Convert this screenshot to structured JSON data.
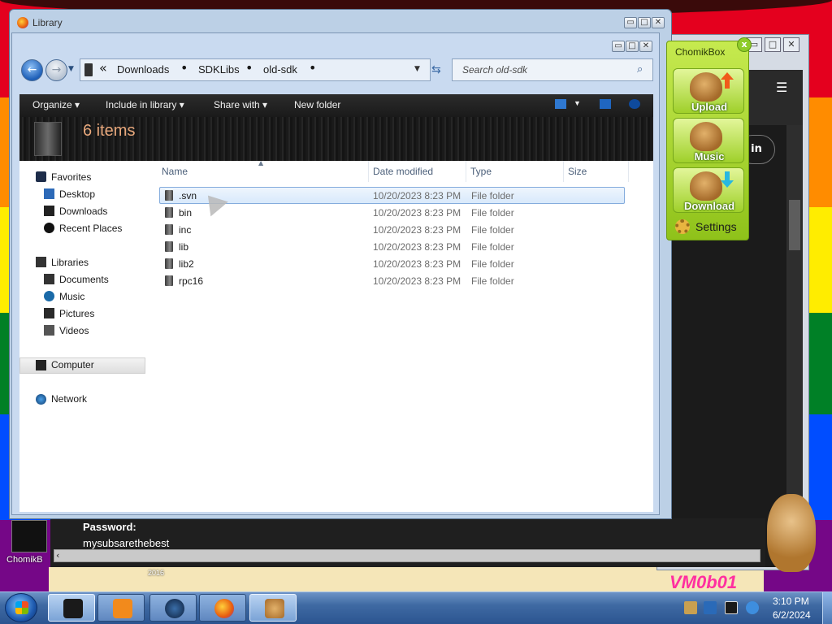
{
  "explorer": {
    "window_title": "Library",
    "breadcrumb": [
      "Downloads",
      "SDKLibs",
      "old-sdk"
    ],
    "search_placeholder": "Search old-sdk",
    "toolbar": {
      "organize": "Organize",
      "include_in_library": "Include in library",
      "share_with": "Share with",
      "new_folder": "New folder"
    },
    "item_count": "6 items",
    "nav_pane": {
      "favorites": "Favorites",
      "desktop": "Desktop",
      "downloads": "Downloads",
      "recent_places": "Recent Places",
      "libraries": "Libraries",
      "documents": "Documents",
      "music": "Music",
      "pictures": "Pictures",
      "videos": "Videos",
      "computer": "Computer",
      "network": "Network"
    },
    "columns": {
      "name": "Name",
      "date": "Date modified",
      "type": "Type",
      "size": "Size"
    },
    "files": [
      {
        "name": ".svn",
        "date": "10/20/2023 8:23 PM",
        "type": "File folder"
      },
      {
        "name": "bin",
        "date": "10/20/2023 8:23 PM",
        "type": "File folder"
      },
      {
        "name": "inc",
        "date": "10/20/2023 8:23 PM",
        "type": "File folder"
      },
      {
        "name": "lib",
        "date": "10/20/2023 8:23 PM",
        "type": "File folder"
      },
      {
        "name": "lib2",
        "date": "10/20/2023 8:23 PM",
        "type": "File folder"
      },
      {
        "name": "rpc16",
        "date": "10/20/2023 8:23 PM",
        "type": "File folder"
      }
    ],
    "selected_row": 0
  },
  "chomikbox": {
    "title": "ChomikBox",
    "close": "x",
    "upload": "Upload",
    "music": "Music",
    "download": "Download",
    "settings": "Settings"
  },
  "background_page": {
    "password_label": "Password:",
    "password_value": "mysubsarethebest",
    "login_button": "in"
  },
  "desktop": {
    "icon_label": "ChomikB",
    "logo_text": "VM0b01",
    "small_text": "2016"
  },
  "taskbar": {
    "time": "3:10 PM",
    "date": "6/2/2024"
  },
  "colors": {
    "chomik_green": "#9fd02a",
    "explorer_toolbar": "#1a1a1a",
    "item_count_text": "#e8a87c",
    "selection": "#d8e9fb"
  }
}
